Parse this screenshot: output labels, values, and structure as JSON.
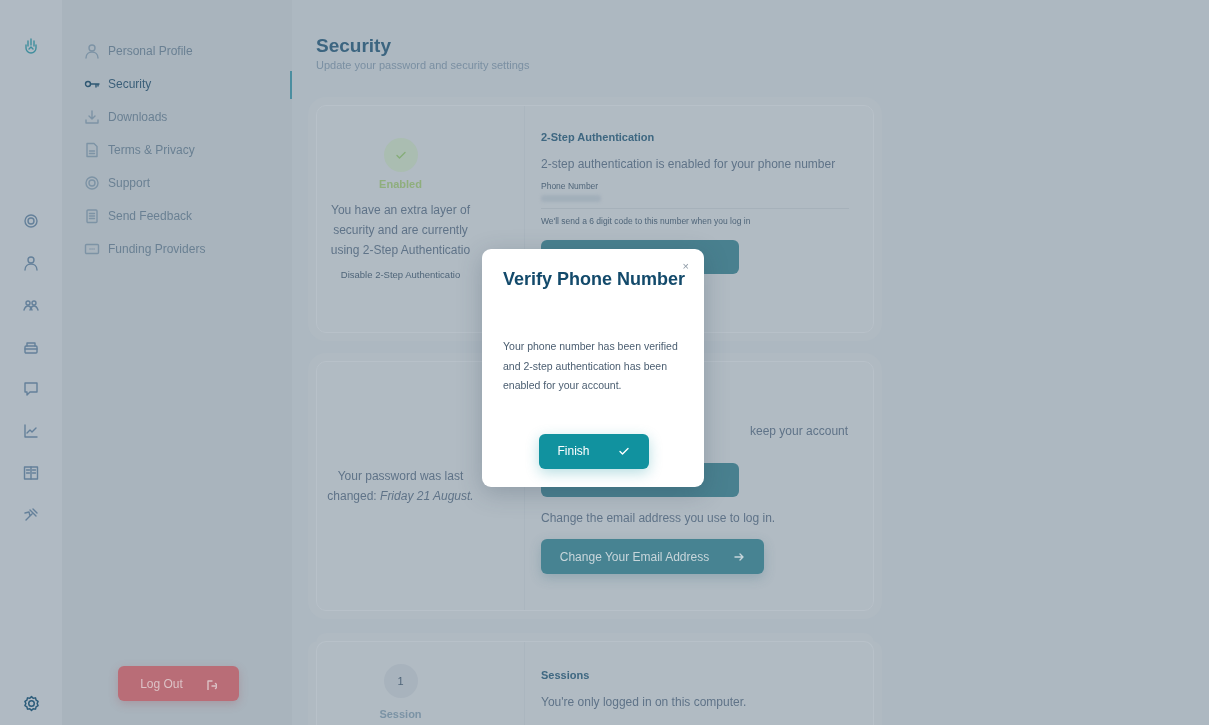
{
  "rail": {
    "items": [
      {
        "selected": false
      },
      {
        "selected": false
      },
      {
        "selected": false
      },
      {
        "selected": false
      },
      {
        "selected": false
      },
      {
        "selected": false
      },
      {
        "selected": false
      },
      {
        "selected": false
      }
    ],
    "bottom_items": [
      {
        "selected": true
      }
    ]
  },
  "sidebar": {
    "items": [
      {
        "label": "Personal Profile",
        "selected": false
      },
      {
        "label": "Security",
        "selected": true
      },
      {
        "label": "Downloads",
        "selected": false
      },
      {
        "label": "Terms & Privacy",
        "selected": false
      },
      {
        "label": "Support",
        "selected": false
      },
      {
        "label": "Send Feedback",
        "selected": false
      },
      {
        "label": "Funding Providers",
        "selected": false
      }
    ],
    "logout": "Log Out"
  },
  "page": {
    "title": "Security",
    "subtitle": "Update your password and security settings"
  },
  "two_step": {
    "status": {
      "label": "Enabled",
      "on": true
    },
    "lines": [
      "You have an extra layer of",
      "security and are currently",
      "using 2-Step Authenticatio"
    ],
    "disable_link": "Disable 2-Step Authenticatio",
    "title": "2-Step Authentication",
    "description": "2-step authentication is enabled for your phone number",
    "phone_label": "Phone Number",
    "hint": "We'll send a 6 digit code to this number when you log in"
  },
  "password": {
    "lines": [
      "Your password was last",
      "changed: *Friday 21 August.*"
    ],
    "fragment": "keep your account",
    "email_text": "Change the email address you use to log in.",
    "email_button": "Change Your Email Address"
  },
  "sessions": {
    "count": "1",
    "count_label": "Session",
    "title": "Sessions",
    "text": "You're only logged in on this computer."
  },
  "modal": {
    "close": "×",
    "title": "Verify Phone Number",
    "body": "Your phone number has been verified and 2-step authentication has been enabled for your account.",
    "button": "Finish"
  }
}
